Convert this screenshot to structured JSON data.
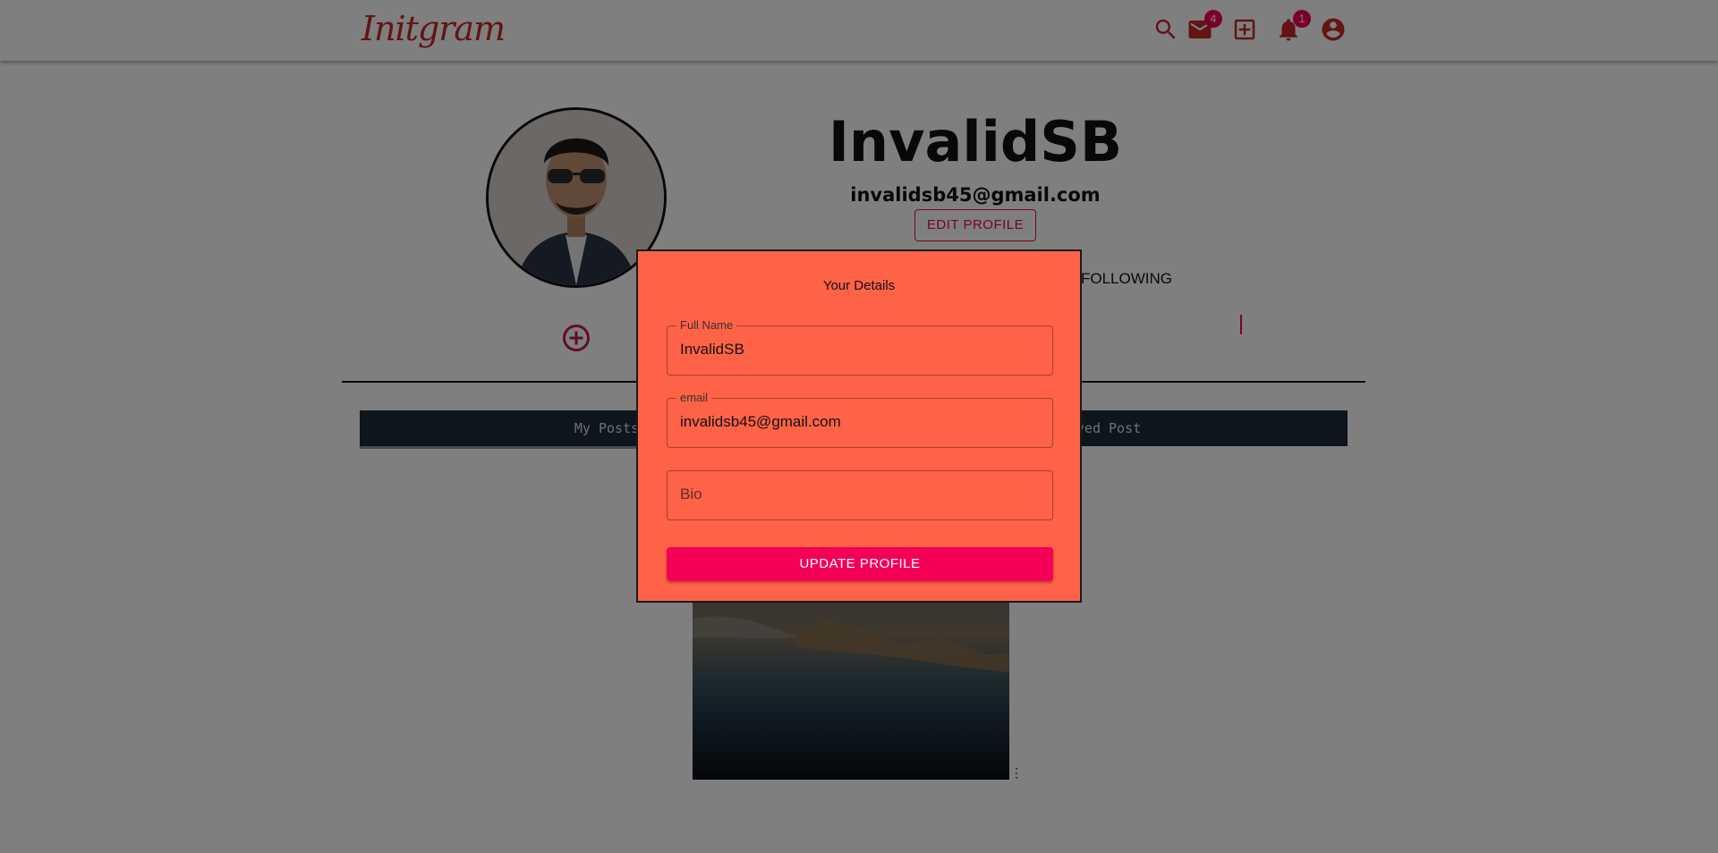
{
  "app": {
    "logo": "Initgram",
    "mail_badge": "4",
    "notification_badge": "1",
    "icons": [
      "search-icon",
      "mail-icon",
      "add-box-icon",
      "notifications-icon",
      "account-circle-icon"
    ],
    "brand_color": "#c62828",
    "accent_color": "#f50057"
  },
  "profile": {
    "username": "InvalidSB",
    "email": "invalidsb45@gmail.com",
    "edit_label": "EDIT PROFILE",
    "following_label": "FOLLOWING"
  },
  "tabs": {
    "my_posts": "My Posts",
    "saved_post": "Saved Post"
  },
  "post": {
    "menu_glyph": "⋮"
  },
  "modal": {
    "title": "Your Details",
    "background_color": "#ff6347",
    "full_name_label": "Full Name",
    "full_name_value": "InvalidSB",
    "email_label": "email",
    "email_value": "invalidsb45@gmail.com",
    "bio_placeholder": "Bio",
    "submit_label": "UPDATE PROFILE"
  }
}
